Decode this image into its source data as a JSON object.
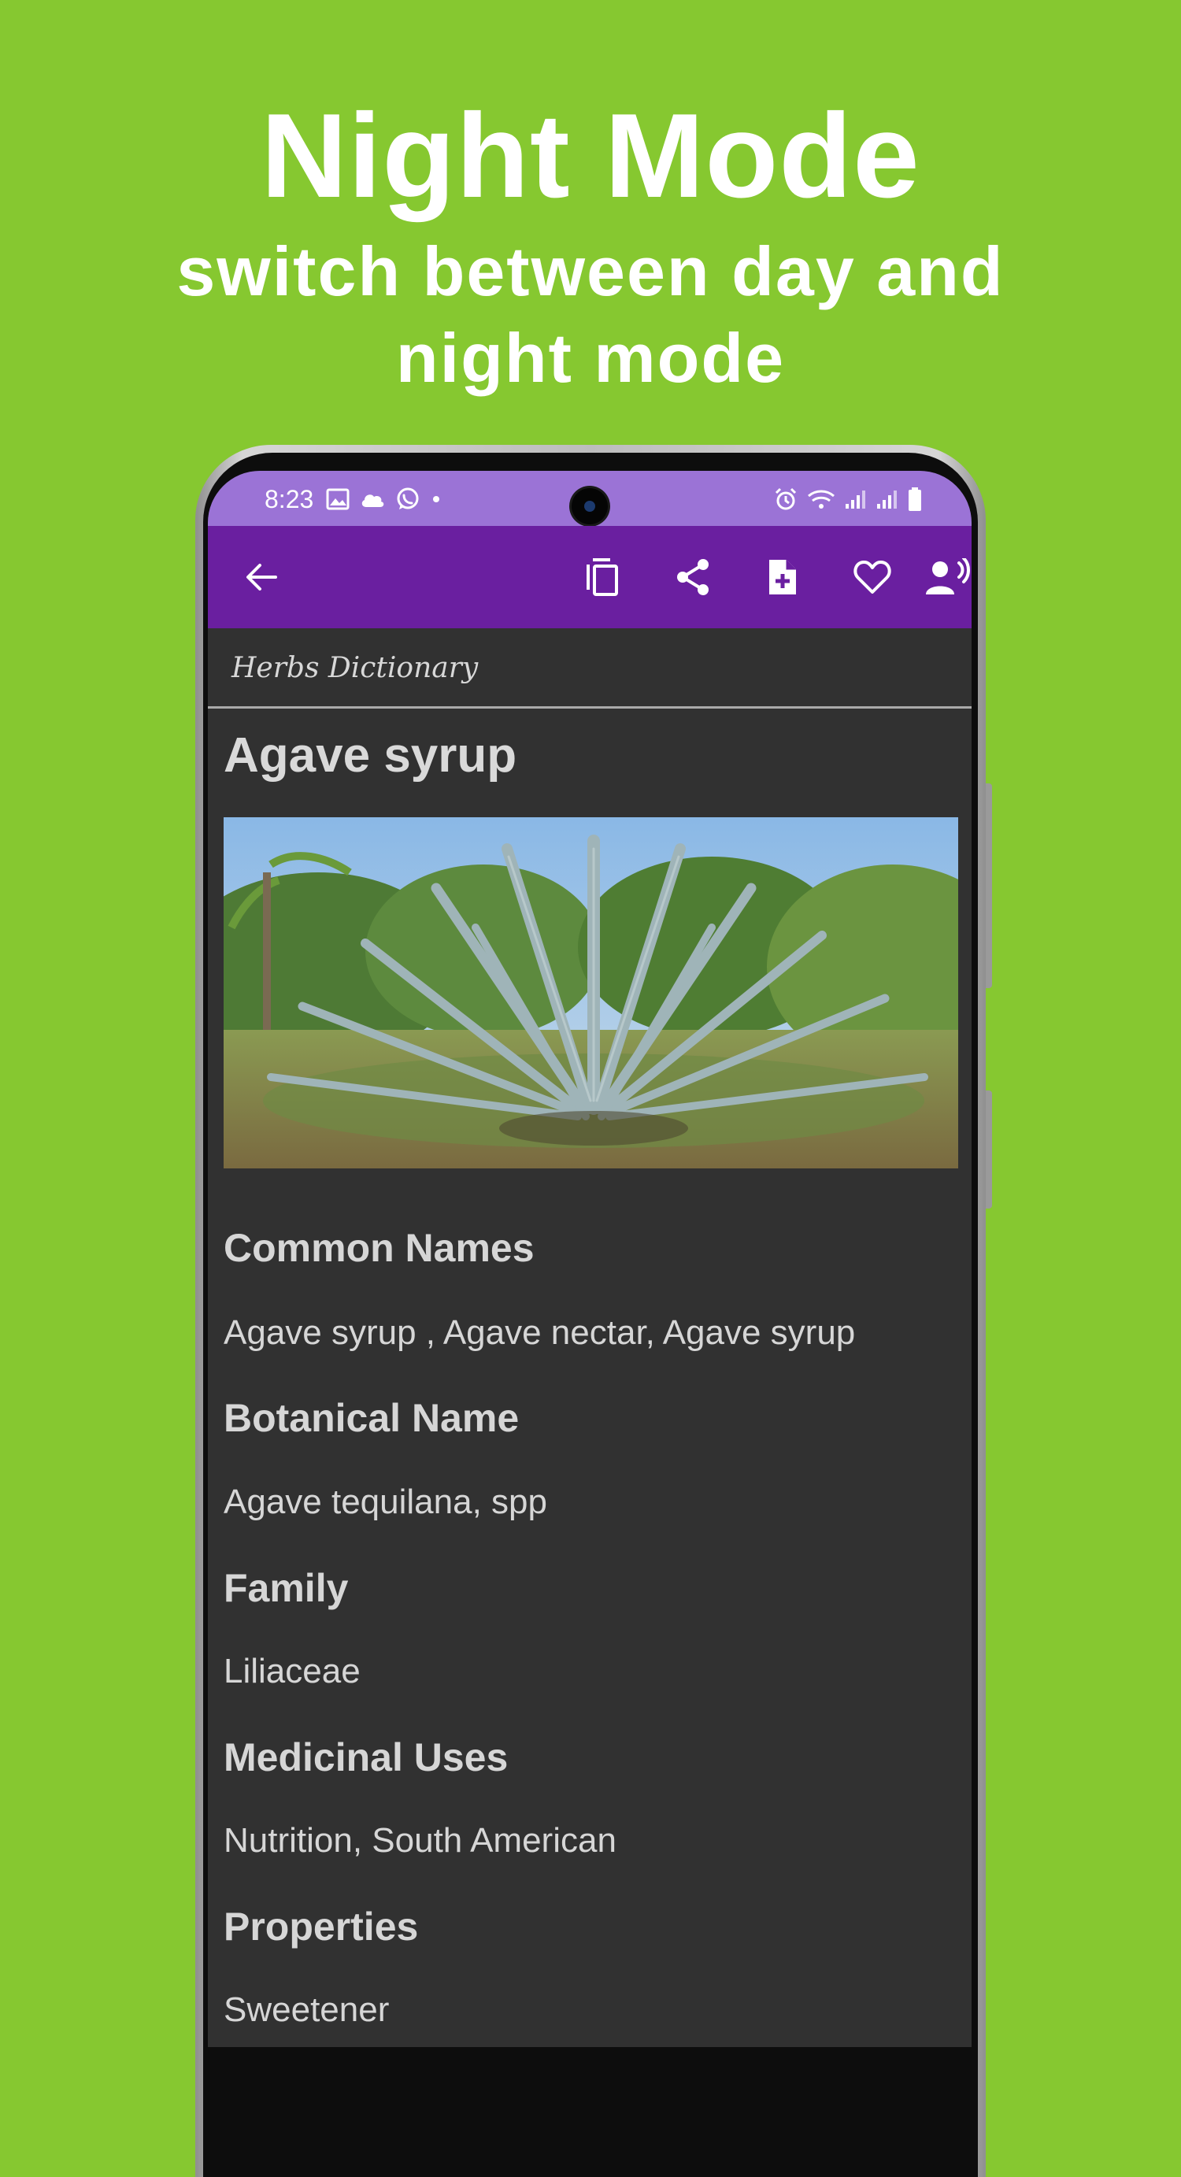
{
  "promo": {
    "title": "Night Mode",
    "subtitle": "switch between day and night mode"
  },
  "status_bar": {
    "time": "8:23",
    "left_icons": [
      "gallery-icon",
      "cloud-icon",
      "whatsapp-icon",
      "dot-icon"
    ],
    "right_icons": [
      "alarm-icon",
      "wifi-icon",
      "signal-icon",
      "signal-icon",
      "battery-icon"
    ]
  },
  "toolbar": {
    "icons": [
      "back-arrow-icon",
      "copy-icon",
      "share-icon",
      "add-note-icon",
      "favorite-icon",
      "text-to-speech-icon"
    ]
  },
  "breadcrumb": {
    "label": "Herbs Dictionary"
  },
  "entry": {
    "title": "Agave syrup",
    "sections": [
      {
        "heading": "Common Names",
        "text": "Agave syrup , Agave nectar, Agave syrup"
      },
      {
        "heading": "Botanical Name",
        "text": "Agave tequilana, spp"
      },
      {
        "heading": "Family",
        "text": "Liliaceae"
      },
      {
        "heading": "Medicinal Uses",
        "text": "Nutrition, South American"
      },
      {
        "heading": "Properties",
        "text": "Sweetener"
      }
    ]
  },
  "colors": {
    "background": "#86c830",
    "status_bar": "#9b73d6",
    "app_bar": "#6a1fa0",
    "screen": "#313131",
    "text": "#d6d6d6"
  }
}
